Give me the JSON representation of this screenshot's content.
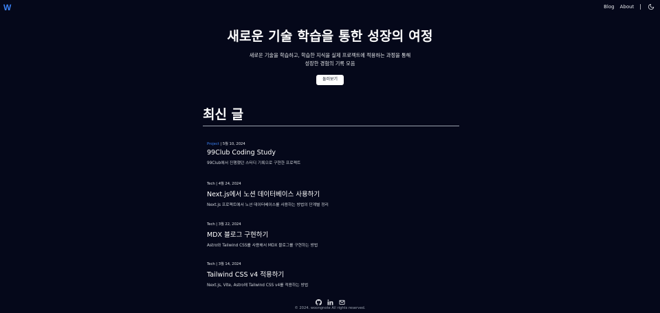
{
  "header": {
    "logo": "W",
    "nav": [
      {
        "label": "Blog"
      },
      {
        "label": "About"
      }
    ],
    "separator": "|",
    "theme_icon": "moon-icon"
  },
  "hero": {
    "title": "새로운 기술 학습을 통한 성장의 여정",
    "description_line1": "새로운 기술을 학습하고, 학습한 지식을 실제 프로젝트에 적용하는 과정을 통해",
    "description_line2": "성장한 경험의 기록 모음",
    "button_label": "둘러보기"
  },
  "latest": {
    "heading": "최신 글",
    "posts": [
      {
        "category": "Project",
        "date": "5월 10, 2024",
        "title": "99Club Coding Study",
        "summary": "99Club에서 진행했던 스터디 기록으로 구현한 프로젝트"
      },
      {
        "category": "Tech",
        "date": "4월 24, 2024",
        "title": "Next.js에서 노션 데이터베이스 사용하기",
        "summary": "Next.js 프로젝트에서 노션 데이터베이스를 사용하는 방법의 단계별 정리"
      },
      {
        "category": "Tech",
        "date": "3월 22, 2024",
        "title": "MDX 블로그 구현하기",
        "summary": "Astro와 Tailwind CSS를 사용해서 MDX 블로그를 구현하는 방법"
      },
      {
        "category": "Tech",
        "date": "3월 14, 2024",
        "title": "Tailwind CSS v4 적용하기",
        "summary": "Next.js, Vite, Astro에 Tailwind CSS v4를 적용하는 방법"
      }
    ],
    "meta_separator": "|"
  },
  "footer": {
    "icons": [
      "github-icon",
      "linkedin-icon",
      "mail-icon"
    ],
    "copyright": "© 2024. woongnote All rights reserved."
  },
  "colors": {
    "background": "#05081a",
    "accent": "#3b82f6"
  }
}
